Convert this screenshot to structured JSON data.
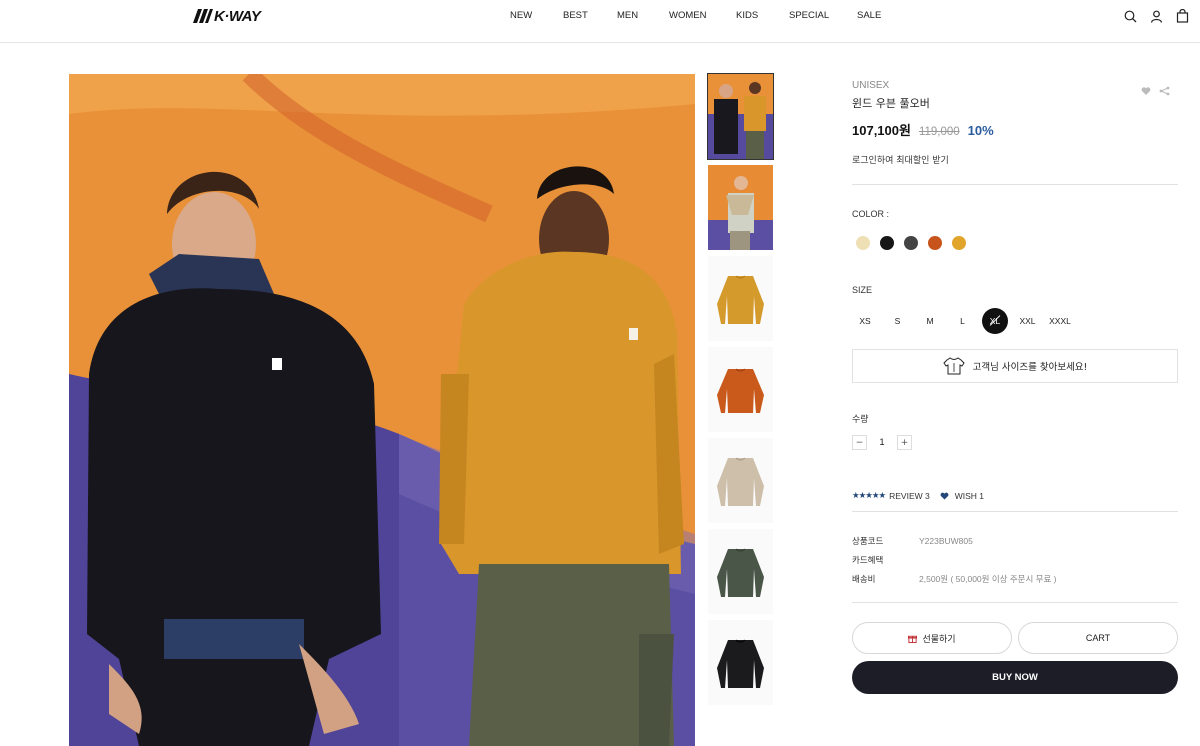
{
  "header": {
    "logo_text": "K·WAY",
    "nav": [
      "NEW",
      "BEST",
      "MEN",
      "WOMEN",
      "KIDS",
      "SPECIAL",
      "SALE"
    ],
    "icons": [
      "search-icon",
      "user-icon",
      "cart-bag-icon"
    ]
  },
  "gallery": {
    "thumbnails": [
      {
        "name": "two-models",
        "active": true
      },
      {
        "name": "model-with-scarf",
        "active": false
      },
      {
        "name": "mustard-pullover",
        "active": false,
        "color": "#d49a2c"
      },
      {
        "name": "orange-pullover",
        "active": false,
        "color": "#c95a1c"
      },
      {
        "name": "beige-pullover",
        "active": false,
        "color": "#cdbfa9"
      },
      {
        "name": "khaki-pullover",
        "active": false,
        "color": "#4a5648"
      },
      {
        "name": "black-pullover",
        "active": false,
        "color": "#1b1b1e"
      }
    ]
  },
  "product": {
    "category": "UNISEX",
    "name": "윈드 우븐 풀오버",
    "price": "107,100원",
    "original_price": "119,000",
    "discount": "10%",
    "login_prompt": "로그인하여 최대할인 받기",
    "color_label": "COLOR :",
    "colors": [
      "#eee0b4",
      "#161616",
      "#444444",
      "#c6541b",
      "#e1a52c"
    ],
    "size_label": "SIZE",
    "sizes": [
      "XS",
      "S",
      "M",
      "L",
      "XL",
      "XXL",
      "XXXL"
    ],
    "selected_size": "XL",
    "size_guide": "고객님 사이즈를 찾아보세요!",
    "qty_label": "수량",
    "qty_minus": "−",
    "qty_value": "1",
    "qty_plus": "+",
    "stars": "★★★★★",
    "review": "REVIEW 3",
    "wish": "WISH 1",
    "meta": [
      {
        "key": "상품코드",
        "value": "Y223BUW805"
      },
      {
        "key": "카드혜택",
        "value": ""
      },
      {
        "key": "배송비",
        "value": "2,500원 ( 50,000원 이상 주문시 무료 )"
      }
    ],
    "gift_button": "선물하기",
    "cart_button": "CART",
    "buy_button": "BUY NOW"
  }
}
